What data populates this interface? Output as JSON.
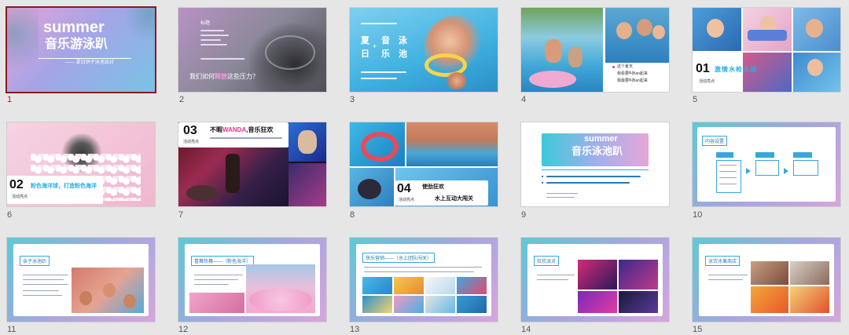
{
  "thumbnails": [
    {
      "num": "1",
      "title": "summer",
      "subtitle": "音乐游泳趴",
      "tagline": "—— 夏日饼子泳池派对"
    },
    {
      "num": "2",
      "small_title": "标题",
      "body_lines": "",
      "question_prefix": "我们如何",
      "question_highlight": "释放",
      "question_suffix": "这些压力？"
    },
    {
      "num": "3",
      "left_block": "夏 + 音 泳 日 乐 池",
      "chars": [
        "夏",
        "音",
        "泳",
        "日",
        "乐",
        "池"
      ],
      "plus": "+"
    },
    {
      "num": "4",
      "caption_line1": "这个夏天",
      "caption_line2": "我看要叫Ban起来",
      "caption_line3": "我最要叫Ban起来"
    },
    {
      "num": "5",
      "index": "01",
      "title": "激情水枪大战",
      "sub": "活动亮点"
    },
    {
      "num": "6",
      "index": "02",
      "title": "粉色海洋球，打造粉色海洋",
      "sub": "活动亮点"
    },
    {
      "num": "7",
      "index": "03",
      "title_prefix": "不暇",
      "title_highlight": "WANDA",
      "title_suffix": ",音乐狂欢",
      "sub": "活动亮点"
    },
    {
      "num": "8",
      "index": "04",
      "title": "使劲狂欢",
      "sub": "活动亮点",
      "tagline": "水上互动大闯关"
    },
    {
      "num": "9",
      "title": "summer",
      "subtitle": "音乐泳池趴"
    },
    {
      "num": "10",
      "tag": "内容设置"
    },
    {
      "num": "11",
      "tag": "亲子泳池趴"
    },
    {
      "num": "12",
      "tag": "喜舞热舞——（粉色海洋）"
    },
    {
      "num": "13",
      "tag": "快乐营销——（水上团队闯关）"
    },
    {
      "num": "14",
      "tag": "狂欢派对"
    },
    {
      "num": "15",
      "tag": "泳饮冰果商店"
    }
  ],
  "colors": {
    "selected": "#8b1a1a",
    "accent_pink": "#e8348a",
    "accent_blue": "#2ab0e8"
  }
}
